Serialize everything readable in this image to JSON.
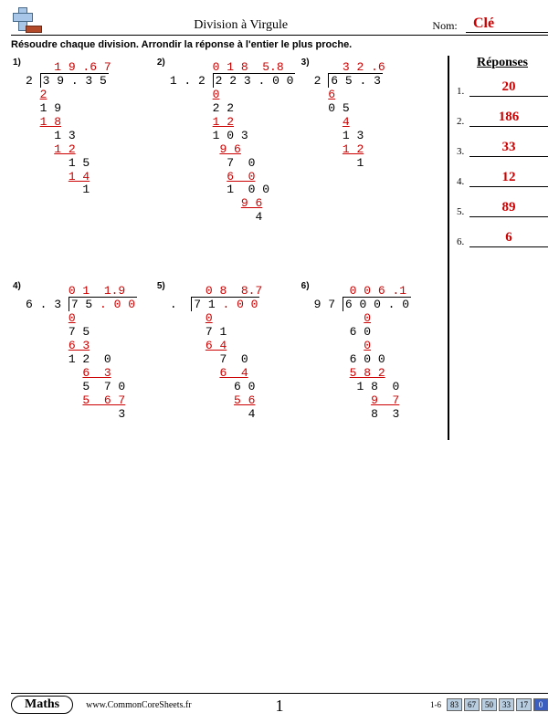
{
  "header": {
    "title": "Division à Virgule",
    "name_label": "Nom:",
    "name_value": "Clé"
  },
  "instruction": "Résoudre chaque division. Arrondir la réponse à l'entier le plus proche.",
  "answers_title": "Réponses",
  "answers": [
    {
      "n": "1.",
      "v": "20"
    },
    {
      "n": "2.",
      "v": "186"
    },
    {
      "n": "3.",
      "v": "33"
    },
    {
      "n": "4.",
      "v": "12"
    },
    {
      "n": "5.",
      "v": "89"
    },
    {
      "n": "6.",
      "v": "6"
    }
  ],
  "problems": {
    "p1": {
      "num": "1)",
      "quotient": "1 9 .6 7",
      "divisor": "2",
      "dividend": "3 9 . 3 5",
      "s1": "2",
      "s2": "1 9",
      "s3": "1 8",
      "s4": "1 3",
      "s5": "1 2",
      "s6": "1 5",
      "s7": "1 4",
      "s8": "1"
    },
    "p2": {
      "num": "2)",
      "quotient": "0 1 8  5.8",
      "divisor": "1 . 2",
      "dividend": "2 2 3 . 0 0",
      "s1": "0",
      "s2": "2 2",
      "s3": "1 2",
      "s4": "1 0 3",
      "s5": "9 6",
      "s6": "7  0",
      "s7": "6  0",
      "s8": "1  0 0",
      "s9": "9 6",
      "s10": "4"
    },
    "p3": {
      "num": "3)",
      "quotient": "3 2 .6",
      "divisor": "2",
      "dividend": "6 5 . 3",
      "s1": "6",
      "s2": "0 5",
      "s3": "4",
      "s4": "1 3",
      "s5": "1 2",
      "s6": "1"
    },
    "p4": {
      "num": "4)",
      "quotient": "0 1  1.9",
      "divisor": "6 . 3",
      "dividend": "7 5 . 0 0",
      "s1": "0",
      "s2": "7 5",
      "s3": "6 3",
      "s4": "1 2  0",
      "s5": "6  3",
      "s6": "5  7 0",
      "s7": "5  6 7",
      "s8": "3"
    },
    "p5": {
      "num": "5)",
      "quotient": "0 8  8.7",
      "divisor": ". ",
      "dividend": "7 1 . 0 0",
      "s1": "0",
      "s2": "7 1",
      "s3": "6 4",
      "s4": "7  0",
      "s5": "6  4",
      "s6": "6 0",
      "s7": "5 6",
      "s8": "4"
    },
    "p6": {
      "num": "6)",
      "quotient": "0 0 6 .1",
      "divisor": "9 7",
      "dividend": "6 0 0 . 0",
      "s1": "0",
      "s2": "6 0",
      "s3": "0",
      "s4": "6 0 0",
      "s5": "5 8 2",
      "s6": "1 8  0",
      "s7": "9  7",
      "s8": "8  3"
    }
  },
  "footer": {
    "maths": "Maths",
    "url": "www.CommonCoreSheets.fr",
    "page": "1",
    "range": "1-6",
    "scores": [
      "83",
      "67",
      "50",
      "33",
      "17",
      "0"
    ],
    "score_colors": [
      "#b8cde0",
      "#b8cde0",
      "#b8cde0",
      "#b8cde0",
      "#b8cde0",
      "#3a5fbf"
    ],
    "score_text": [
      "#000",
      "#000",
      "#000",
      "#000",
      "#000",
      "#fff"
    ]
  }
}
